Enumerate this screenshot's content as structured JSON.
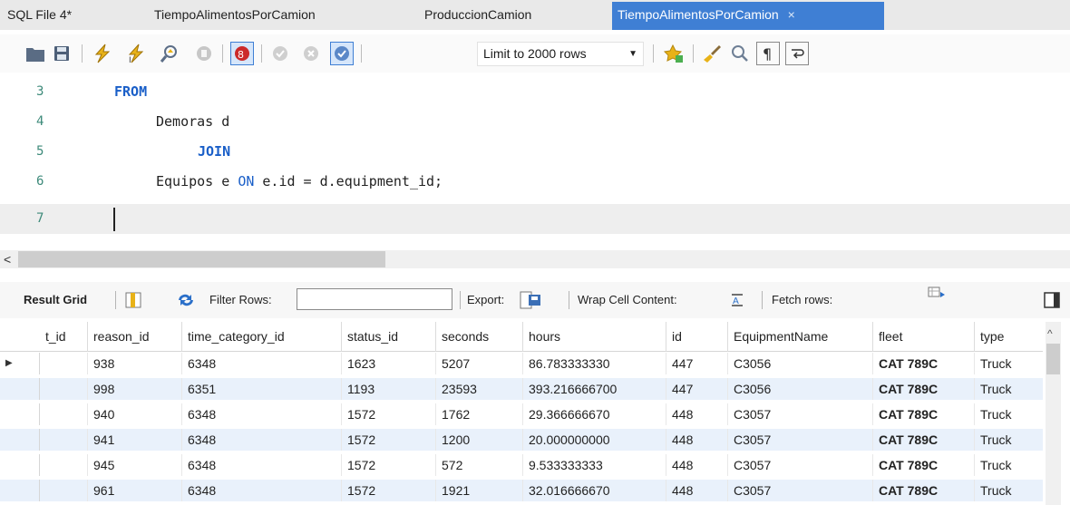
{
  "tabs": [
    {
      "label": "SQL File 4*"
    },
    {
      "label": "TiempoAlimentosPorCamion"
    },
    {
      "label": "ProduccionCamion"
    },
    {
      "label": "TiempoAlimentosPorCamion",
      "close": "×"
    }
  ],
  "toolbar": {
    "icons": [
      "open-folder-icon",
      "save-icon",
      "execute-icon",
      "execute-current-icon",
      "explain-icon",
      "stop-icon",
      "toggle-continue-on-error-icon",
      "commit-icon",
      "rollback-icon",
      "autocommit-icon",
      "limit-rows-select",
      "beautify-icon",
      "brush-icon",
      "find-icon",
      "invisible-chars-icon",
      "wrap-icon"
    ],
    "limit_label": "Limit to 2000 rows",
    "limit_caret": "▼"
  },
  "editor": {
    "lines": [
      {
        "number": "3",
        "kw": "FROM"
      },
      {
        "number": "4",
        "text": "Demoras d"
      },
      {
        "number": "5",
        "kw": "JOIN"
      },
      {
        "number": "6",
        "pre": "Equipos e ",
        "kw": "ON",
        "post": " e.id = d.equipment_id;"
      },
      {
        "number": "7"
      }
    ]
  },
  "hscroll": {
    "left_arrow": "<"
  },
  "result_toolbar": {
    "result_grid": "Result Grid",
    "filter_rows": "Filter Rows:",
    "export": "Export:",
    "wrap_cell": "Wrap Cell Content:",
    "fetch_rows": "Fetch rows:"
  },
  "grid": {
    "columns": [
      "t_id",
      "reason_id",
      "time_category_id",
      "status_id",
      "seconds",
      "hours",
      "id",
      "EquipmentName",
      "fleet",
      "type"
    ],
    "rows": [
      [
        "",
        "938",
        "6348",
        "1623",
        "5207",
        "86.783333330",
        "447",
        "C3056",
        "CAT 789C",
        "Truck"
      ],
      [
        "",
        "998",
        "6351",
        "1193",
        "23593",
        "393.216666700",
        "447",
        "C3056",
        "CAT 789C",
        "Truck"
      ],
      [
        "",
        "940",
        "6348",
        "1572",
        "1762",
        "29.366666670",
        "448",
        "C3057",
        "CAT 789C",
        "Truck"
      ],
      [
        "",
        "941",
        "6348",
        "1572",
        "1200",
        "20.000000000",
        "448",
        "C3057",
        "CAT 789C",
        "Truck"
      ],
      [
        "",
        "945",
        "6348",
        "1572",
        "572",
        "9.533333333",
        "448",
        "C3057",
        "CAT 789C",
        "Truck"
      ],
      [
        "",
        "961",
        "6348",
        "1572",
        "1921",
        "32.016666670",
        "448",
        "C3057",
        "CAT 789C",
        "Truck"
      ]
    ],
    "current_row_marker": "▶"
  },
  "colors": {
    "accent": "#3f7fd4",
    "keyword": "#1a5fc8",
    "line_number": "#3d8a7a",
    "alt_row": "#e9f1fb"
  }
}
